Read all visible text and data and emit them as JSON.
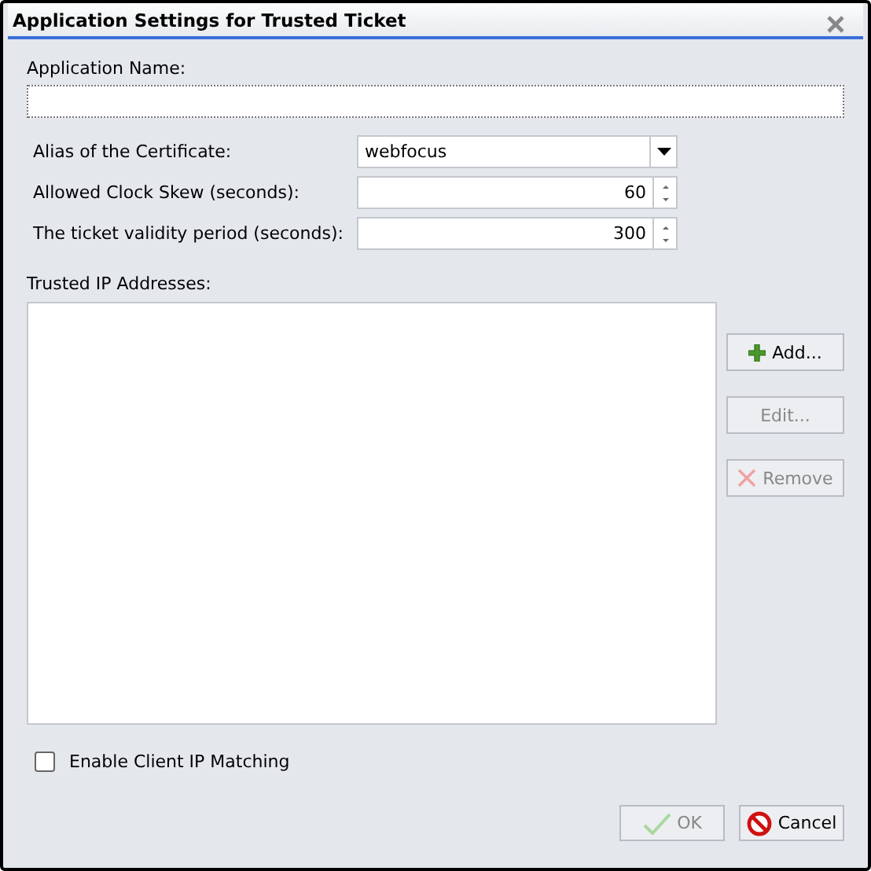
{
  "window": {
    "title": "Application Settings for Trusted Ticket"
  },
  "application_name": {
    "label": "Application Name:"
  },
  "fields": [
    {
      "kind": "dropdown",
      "label": "Alias of the Certificate:",
      "value": "webfocus"
    },
    {
      "kind": "spinner",
      "label": "Allowed Clock Skew (seconds):",
      "value": "60"
    },
    {
      "kind": "spinner",
      "label": "The ticket validity period (seconds):",
      "value": "300"
    }
  ],
  "trusted_ip": {
    "label": "Trusted IP Addresses:"
  },
  "side_buttons": [
    {
      "kind": "add",
      "label": "Add...",
      "disabled": false
    },
    {
      "kind": "edit",
      "label": "Edit...",
      "disabled": true
    },
    {
      "kind": "remove",
      "label": "Remove",
      "disabled": true
    }
  ],
  "client_ip_matching": {
    "label": "Enable Client IP Matching",
    "checked": false
  },
  "buttons": [
    {
      "kind": "ok",
      "label": "OK",
      "disabled": true
    },
    {
      "kind": "cancel",
      "label": "Cancel",
      "disabled": false
    }
  ]
}
